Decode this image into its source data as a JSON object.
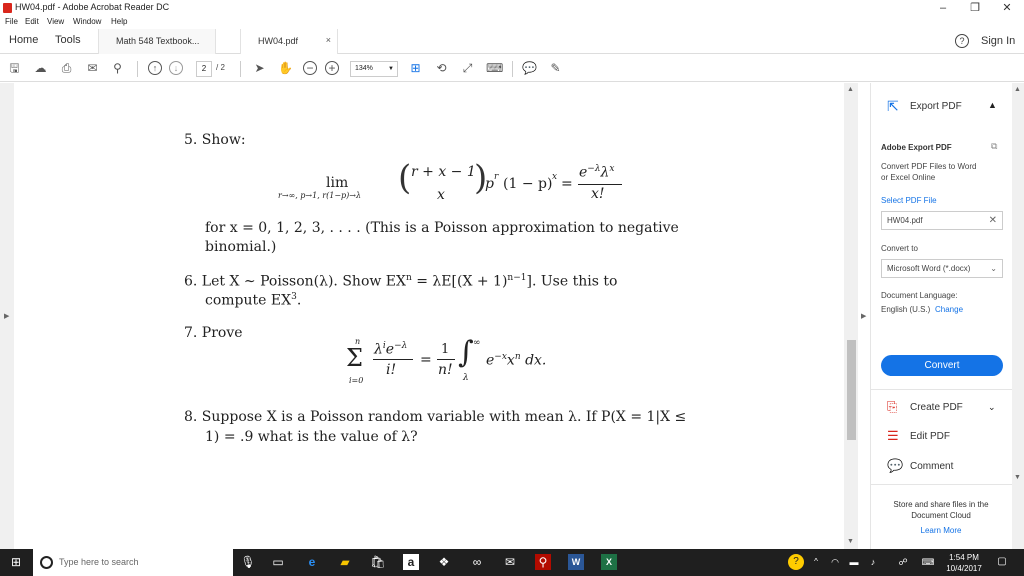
{
  "window": {
    "title": "HW04.pdf - Adobe Acrobat Reader DC",
    "minimize": "–",
    "maximize": "❐",
    "close": "✕"
  },
  "menu": [
    "File",
    "Edit",
    "View",
    "Window",
    "Help"
  ],
  "tabs": {
    "home": "Home",
    "tools": "Tools",
    "docs": [
      {
        "label": "Math 548 Textbook...",
        "active": false
      },
      {
        "label": "HW04.pdf",
        "active": true,
        "close": "×"
      }
    ],
    "help": "?",
    "signin": "Sign In"
  },
  "toolbar": {
    "page_current": "2",
    "page_total": "/ 2",
    "zoom": "134%"
  },
  "document": {
    "p5": {
      "label": "5. Show:",
      "lim": "lim",
      "lim_sub": "r→∞, p→1, r(1−p)→λ",
      "binom_top": "r + x − 1",
      "binom_bot": "x",
      "after_binom": "p",
      "r_sup": "r",
      "one_minus_p": "(1 − p)",
      "x_sup": "x",
      "equals": "=",
      "rhs_num": "e",
      "rhs_num_sup": "−λ",
      "rhs_num_tail": "λ",
      "rhs_num_tail_sup": "x",
      "rhs_den": "x!",
      "line1": "for x = 0, 1, 2, 3, . . . .  (This is a Poisson approximation to negative",
      "line2": "binomial.)"
    },
    "p6": {
      "line1": "6. Let X ∼ Poisson(λ). Show EX",
      "n_sup": "n",
      "line1b": " = λE[(X + 1)",
      "n1_sup": "n−1",
      "line1c": "]. Use this to",
      "line2": "compute EX",
      "three_sup": "3",
      "period": "."
    },
    "p7": {
      "label": "7. Prove",
      "sum_top": "n",
      "sum_bot": "i=0",
      "sigma": "Σ",
      "frac1_num": "λ",
      "frac1_num_sup": "i",
      "frac1_num_e": "e",
      "frac1_num_e_sup": "−λ",
      "frac1_den": "i!",
      "eq": "=",
      "frac2_num": "1",
      "frac2_den": "n!",
      "integral": "∫",
      "int_top": "∞",
      "int_bot": "λ",
      "integrand": "e",
      "integrand_sup": "−x",
      "integrand_x": "x",
      "integrand_n": "n",
      "dx": " dx."
    },
    "p8": {
      "line1": "8. Suppose X is a Poisson random variable with mean λ. If P(X = 1|X ≤",
      "line2": "1) = .9 what is the value of λ?"
    }
  },
  "right_panel": {
    "export_header": "Export PDF",
    "adobe_export": "Adobe Export PDF",
    "convert_desc_1": "Convert PDF Files to Word",
    "convert_desc_2": "or Excel Online",
    "select_pdf": "Select PDF File",
    "file_value": "HW04.pdf",
    "convert_to": "Convert to",
    "word_value": "Microsoft Word (*.docx)",
    "doc_lang": "Document Language:",
    "lang_value": "English (U.S.)",
    "change": "Change",
    "convert_btn": "Convert",
    "create_pdf": "Create PDF",
    "edit_pdf": "Edit PDF",
    "comment": "Comment",
    "store_1": "Store and share files in the",
    "store_2": "Document Cloud",
    "learn_more": "Learn More"
  },
  "taskbar": {
    "search_placeholder": "Type here to search",
    "time": "1:54 PM",
    "date": "10/4/2017"
  },
  "colors": {
    "accent_blue": "#1473e6",
    "pdf_red": "#d9261c"
  }
}
